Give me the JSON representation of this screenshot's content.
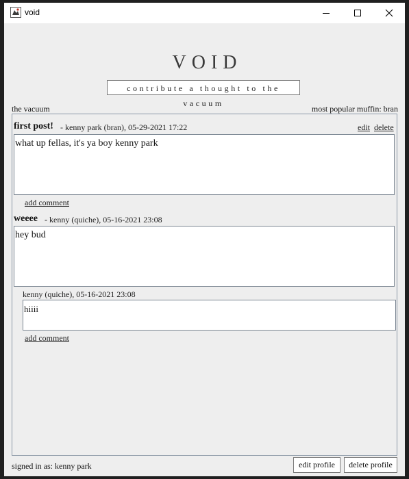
{
  "window": {
    "title": "void",
    "controls": [
      "minimize-icon",
      "maximize-icon",
      "close-icon"
    ]
  },
  "header": {
    "title": "VOID",
    "contribute_label": "contribute a thought to the vacuum"
  },
  "labels": {
    "vacuum": "the vacuum",
    "popular": "most popular muffin: bran"
  },
  "posts": [
    {
      "title": "first post!",
      "meta": "-  kenny park (bran), 05-29-2021 17:22",
      "body": "what up fellas, it's ya boy kenny park",
      "edit_label": "edit",
      "delete_label": "delete",
      "add_comment_label": "add comment"
    },
    {
      "title": "weeee",
      "meta": "-  kenny (quiche), 05-16-2021 23:08",
      "body": "hey bud",
      "comments": [
        {
          "meta": "kenny (quiche), 05-16-2021 23:08",
          "body": "hiiii"
        }
      ],
      "add_comment_label": "add comment"
    }
  ],
  "footer": {
    "signed_in": "signed in as: kenny park",
    "edit_profile_label": "edit profile",
    "delete_profile_label": "delete profile"
  }
}
